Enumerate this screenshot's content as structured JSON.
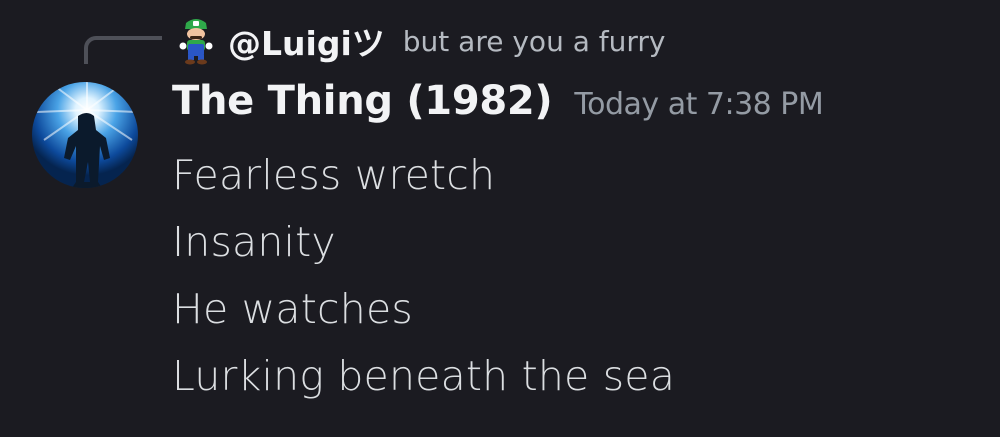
{
  "reply": {
    "author": "@Luigiツ",
    "text": "but are you a furry",
    "avatar_icon": "luigi-sprite-icon"
  },
  "message": {
    "author": "The Thing (1982)",
    "timestamp": "Today at 7:38 PM",
    "avatar_icon": "the-thing-poster-avatar",
    "lines": [
      "Fearless wretch",
      "Insanity",
      "He watches",
      "Lurking beneath the sea"
    ]
  },
  "colors": {
    "background": "#1b1b21",
    "author": "#f2f3f5",
    "timestamp": "#949ba4",
    "body_text": "#dbdee1",
    "reply_text": "#b5bac1"
  }
}
